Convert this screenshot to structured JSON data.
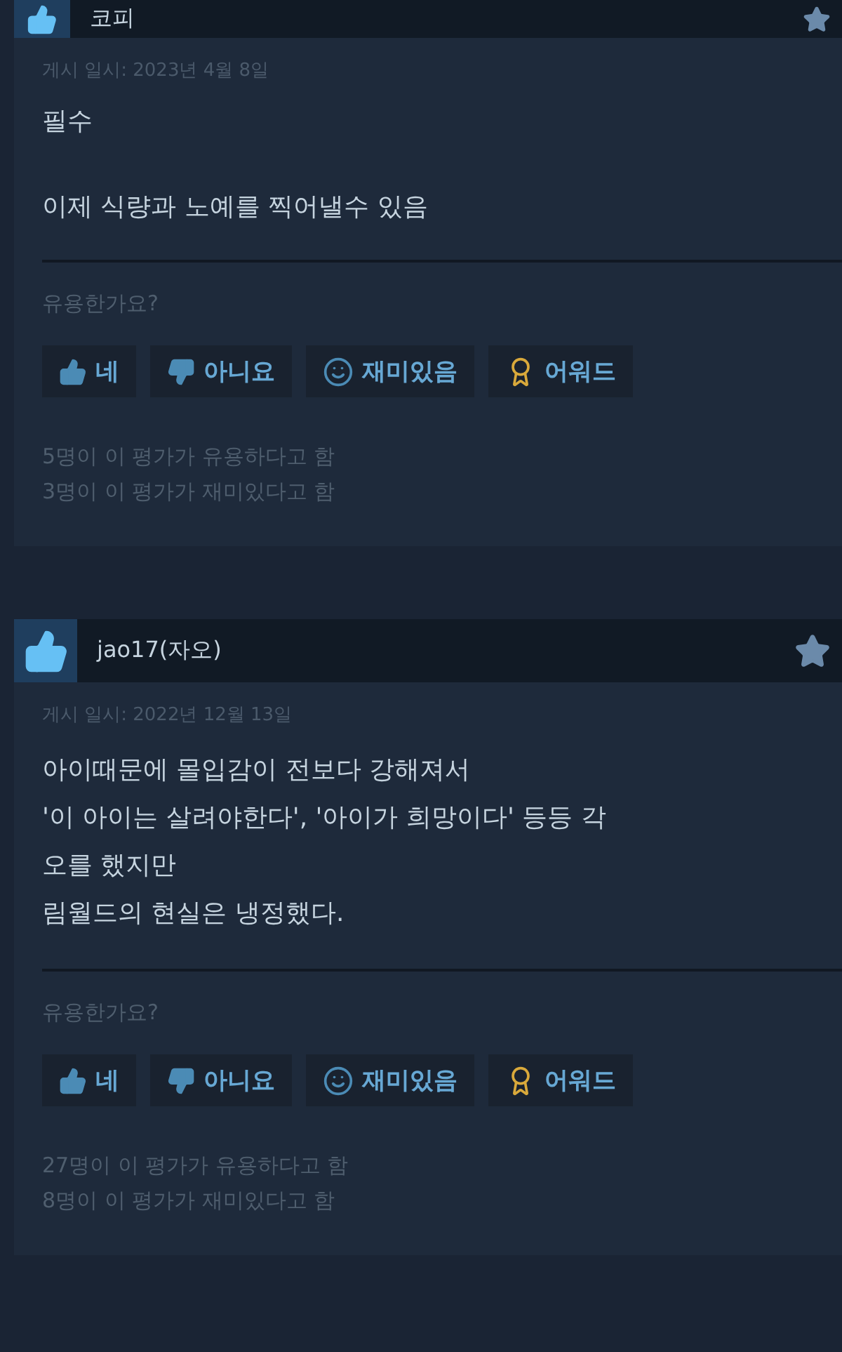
{
  "reviews": [
    {
      "author": "코피",
      "date": "게시 일시: 2023년 4월 8일",
      "paragraphs": [
        "필수",
        "이제 식량과 노예를 찍어낼수 있음"
      ],
      "helpful_prompt": "유용한가요?",
      "buttons": [
        {
          "kind": "yes",
          "label": "네"
        },
        {
          "kind": "no",
          "label": "아니요"
        },
        {
          "kind": "funny",
          "label": "재미있음"
        },
        {
          "kind": "award",
          "label": "어워드"
        }
      ],
      "stats": [
        "5명이 이 평가가 유용하다고 함",
        "3명이 이 평가가 재미있다고 함"
      ]
    },
    {
      "author": "jao17(자오)",
      "date": "게시 일시: 2022년 12월 13일",
      "paragraphs": [
        "아이때문에 몰입감이 전보다 강해져서\n'이 아이는 살려야한다', '아이가 희망이다' 등등 각\n오를 했지만\n림월드의 현실은 냉정했다."
      ],
      "helpful_prompt": "유용한가요?",
      "buttons": [
        {
          "kind": "yes",
          "label": "네"
        },
        {
          "kind": "no",
          "label": "아니요"
        },
        {
          "kind": "funny",
          "label": "재미있음"
        },
        {
          "kind": "award",
          "label": "어워드"
        }
      ],
      "stats": [
        "27명이 이 평가가 유용하다고 함",
        "8명이 이 평가가 재미있다고 함"
      ]
    }
  ]
}
